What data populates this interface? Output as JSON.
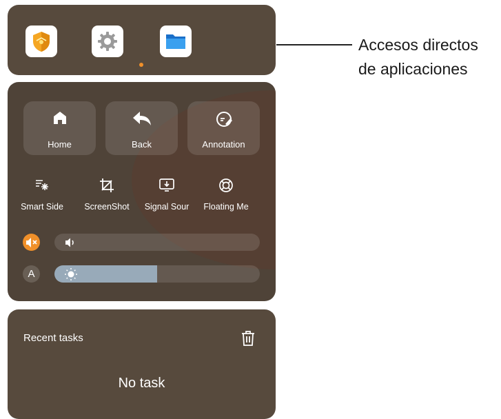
{
  "app_shortcuts": {
    "icons": [
      "security-shield-icon",
      "settings-gear-icon",
      "file-manager-folder-icon"
    ],
    "active_page_dot": 1
  },
  "quick_buttons": [
    {
      "label": "Home",
      "icon": "home-icon"
    },
    {
      "label": "Back",
      "icon": "back-arrow-icon"
    },
    {
      "label": "Annotation",
      "icon": "annotation-pen-icon"
    }
  ],
  "tools": [
    {
      "label": "Smart Side",
      "icon": "smart-side-icon"
    },
    {
      "label": "ScreenShot",
      "icon": "crop-icon"
    },
    {
      "label": "Signal Sour",
      "icon": "signal-source-icon"
    },
    {
      "label": "Floating Me",
      "icon": "floating-menu-icon"
    }
  ],
  "volume": {
    "muted": true,
    "level": 0,
    "leading_icon": "mute-icon",
    "slider_icon": "volume-icon"
  },
  "brightness": {
    "auto_label": "A",
    "level": 0.5,
    "slider_icon": "sun-icon"
  },
  "recent_tasks": {
    "title": "Recent tasks",
    "empty_text": "No task",
    "clear_icon": "trash-icon"
  },
  "annotation": {
    "line1": "Accesos directos",
    "line2": "de aplicaciones"
  },
  "colors": {
    "panel": "#574a3d",
    "accent": "#f0902a",
    "slider_fill": "#98aab9"
  }
}
